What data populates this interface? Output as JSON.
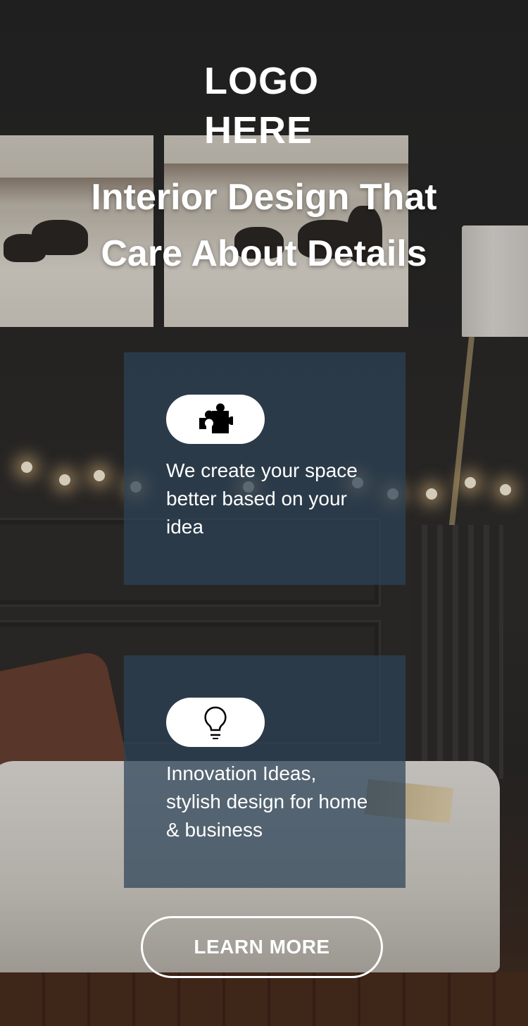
{
  "logo": {
    "text": "LOGO\nHERE"
  },
  "hero": {
    "headline": "Interior Design That Care About Details"
  },
  "features": [
    {
      "icon": "puzzle-icon",
      "text": "We create your space better based on your idea"
    },
    {
      "icon": "lightbulb-icon",
      "text": "Innovation Ideas, stylish design for home & business"
    }
  ],
  "cta": {
    "label": "LEARN MORE"
  },
  "colors": {
    "card_background": "#2d4258",
    "text": "#ffffff",
    "pill": "#ffffff"
  }
}
